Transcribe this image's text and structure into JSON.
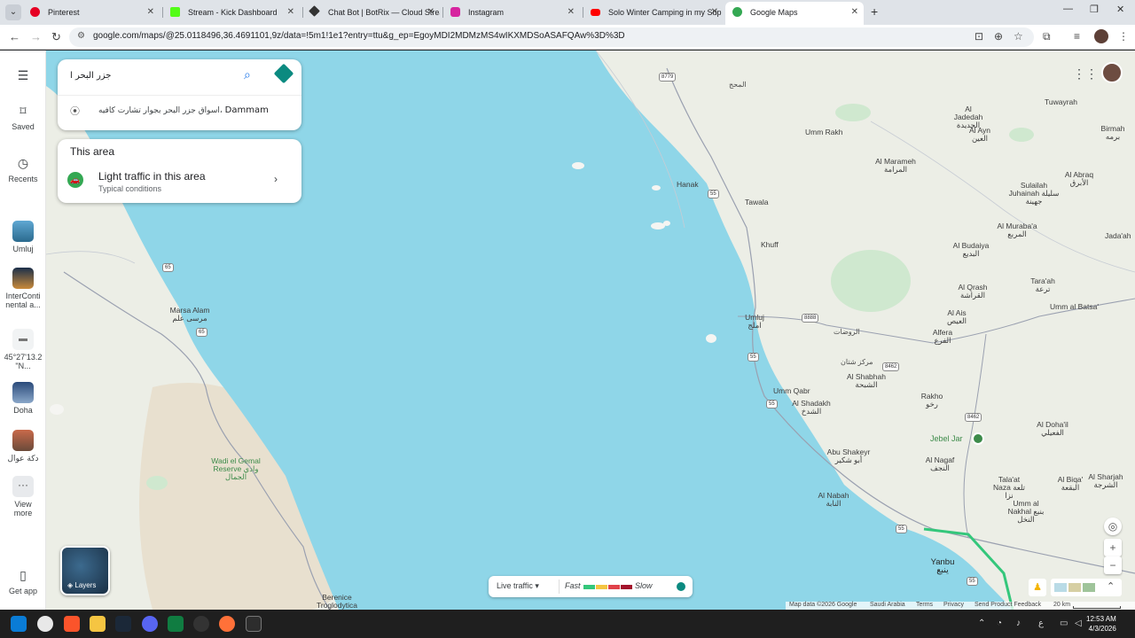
{
  "browser": {
    "tabs": [
      {
        "title": "Pinterest",
        "color": "#e60023"
      },
      {
        "title": "Stream - Kick Dashboard",
        "color": "#53fc18"
      },
      {
        "title": "Chat Bot | BotRix — Cloud Strea",
        "color": "#333333"
      },
      {
        "title": "Instagram",
        "color": "#d6249f"
      },
      {
        "title": "Solo Winter Camping in my Sup",
        "color": "#ff0000"
      },
      {
        "title": "Google Maps",
        "color": "#34a853"
      }
    ],
    "url": "google.com/maps/@25.0118496,36.4691101,9z/data=!5m1!1e1?entry=ttu&g_ep=EgoyMDI2MDMzMS4wIKXMDSoASAFQAw%3D%3D"
  },
  "leftnav": {
    "menu_icon": "hamburger-icon",
    "saved": "Saved",
    "recents": "Recents",
    "recent_items": [
      {
        "label": "Umluj"
      },
      {
        "label": "InterConti nental a..."
      },
      {
        "label": "45°27'13.2 \"N..."
      },
      {
        "label": "Doha"
      },
      {
        "label": "دكة عوال"
      }
    ],
    "view_more": "View more",
    "get_app": "Get app"
  },
  "search": {
    "value": "جزر البحر ا",
    "suggestion_place": "اسواق جزر البحر بجوار تشارت كافيه،",
    "suggestion_city": "Dammam"
  },
  "area": {
    "title": "This area",
    "traffic_title": "Light traffic in this area",
    "traffic_sub": "Typical conditions"
  },
  "map": {
    "labels": {
      "almahaj": "المحج",
      "aljadedah": "Al Jadedah الجديدة",
      "tuwayrah": "Tuwayrah",
      "birmah": "Birmah برمه",
      "alayn": "Al Ayn العين",
      "ummrakh": "Umm Rakh",
      "almarameh": "Al Marameh المرامة",
      "alabraq": "Al Abraq الأبرق",
      "sulailah": "Sulailah Juhainah سليلة جهينة",
      "hanak": "Hanak",
      "tawala": "Tawala",
      "khuff": "Khuff",
      "almuraba": "Al Muraba'a المربع",
      "jadah": "Jada'ah",
      "albudaiya": "Al Budaiya البديع",
      "taraah": "Tara'ah ترعة",
      "alqrash": "Al Qrash القراشة",
      "ummalbatsa": "Umm al Batsa'",
      "alais": "Al Ais العيص",
      "marsaalam": "Marsa Alam مرسى علم",
      "umluj": "Umluj املج",
      "alrawdat": "الروضات",
      "alfera": "Alfera الفرع",
      "markazshitan": "مركز شتان",
      "alshabhah": "Al Shabhah الشبحة",
      "ummqabr": "Umm Qabr",
      "alshadakh": "Al Shadakh الشدخ",
      "rakho": "Rakho رخو",
      "aldaghail": "Al Doha'il الفعيلي",
      "jebeljar": "Jebel Jar",
      "abushakeyr": "Abu Shakeyr أبو شكير",
      "alnagaf": "Al Nagaf النجف",
      "talaatnaza": "Tala'at Naza تلعة نزا",
      "alshariqah": "Al Sharjah الشرجة",
      "wadielgemal": "Wadi el Gemal Reserve وادي الجمال",
      "alnabah": "Al Nabah النابة",
      "albiqa": "Al Biqa' البقعة",
      "ummalnakhal": "Umm al Nakhal بنبع النخل",
      "yanbu": "Yanbu ينبع",
      "berenice": "Berenice Troglodytica"
    },
    "roads": [
      "8779",
      "55",
      "65",
      "65",
      "8888",
      "55",
      "8462",
      "55",
      "8462",
      "55",
      "55"
    ]
  },
  "controls": {
    "layers": "Layers",
    "live_traffic": "Live traffic",
    "fast": "Fast",
    "slow": "Slow",
    "traffic_colors": [
      "#34c77b",
      "#f4c542",
      "#e0424a",
      "#a3142c"
    ]
  },
  "attribution": {
    "mapdata": "Map data ©2026 Google",
    "country": "Saudi Arabia",
    "terms": "Terms",
    "privacy": "Privacy",
    "feedback": "Send Product Feedback",
    "scale": "20 km"
  },
  "taskbar": {
    "time": "12:53 AM",
    "date": "4/3/2026",
    "lang": "ع"
  }
}
